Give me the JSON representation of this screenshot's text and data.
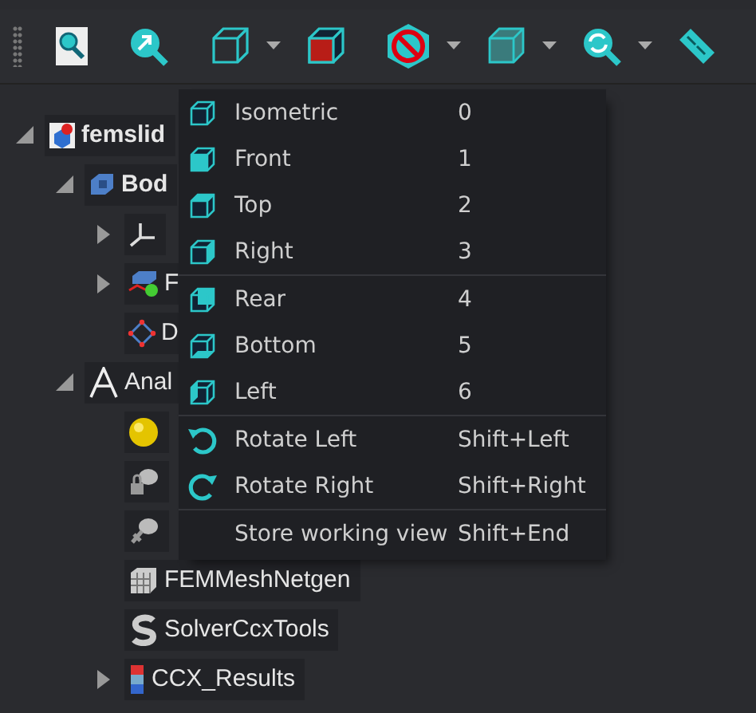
{
  "toolbar": [
    {
      "menu": false
    },
    {
      "menu": false
    },
    {
      "menu": true
    },
    {
      "menu": false
    },
    {
      "menu": true
    },
    {
      "menu": true
    },
    {
      "menu": true
    },
    {
      "menu": false
    }
  ],
  "tree": [
    {
      "label": "femslid",
      "kind": "branch",
      "expanded": true,
      "children": [
        {
          "label": "Bod",
          "kind": "branch",
          "active": true,
          "expanded": true,
          "children": [
            {
              "kind": "branch",
              "expanded": false
            },
            {
              "label": "F",
              "kind": "branch",
              "expanded": false
            },
            {
              "label": "D",
              "kind": "leaf"
            }
          ]
        },
        {
          "label": "Anal",
          "kind": "branch",
          "active": false,
          "expanded": true,
          "children": [
            {
              "kind": "leaf"
            },
            {
              "kind": "leaf"
            },
            {
              "kind": "leaf"
            },
            {
              "label": "FEMMeshNetgen",
              "kind": "leaf"
            },
            {
              "label": "SolverCcxTools",
              "kind": "leaf"
            },
            {
              "label": "CCX_Results",
              "kind": "branch",
              "expanded": false
            }
          ]
        }
      ]
    }
  ],
  "view_menu": {
    "sections": [
      [
        {
          "label": "Isometric",
          "shortcut": "0"
        },
        {
          "label": "Front",
          "shortcut": "1"
        },
        {
          "label": "Top",
          "shortcut": "2"
        },
        {
          "label": "Right",
          "shortcut": "3"
        }
      ],
      [
        {
          "label": "Rear",
          "shortcut": "4"
        },
        {
          "label": "Bottom",
          "shortcut": "5"
        },
        {
          "label": "Left",
          "shortcut": "6"
        }
      ],
      [
        {
          "label": "Rotate Left",
          "shortcut": "Shift+Left"
        },
        {
          "label": "Rotate Right",
          "shortcut": "Shift+Right"
        }
      ],
      [
        {
          "label": "Store working view",
          "shortcut": "Shift+End"
        }
      ]
    ]
  }
}
